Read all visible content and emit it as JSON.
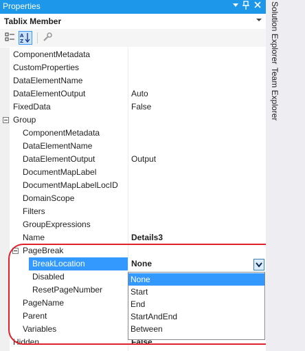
{
  "window": {
    "title": "Properties",
    "dropdown_glyph": "▼",
    "pin_glyph": "ᵖ",
    "close_glyph": "✕"
  },
  "object_selector": {
    "name": "Tablix Member",
    "arrow": "▼"
  },
  "toolbar": {
    "buttons": [
      {
        "icon": "categorized-icon",
        "active": false
      },
      {
        "icon": "alphabetical-icon",
        "active": true
      },
      {
        "icon": "property-pages-icon",
        "active": false
      }
    ]
  },
  "side_tabs": [
    "Solution Explorer",
    "Team Explorer"
  ],
  "properties": {
    "component_metadata": {
      "label": "ComponentMetadata",
      "value": ""
    },
    "custom_properties": {
      "label": "CustomProperties",
      "value": ""
    },
    "data_element_name": {
      "label": "DataElementName",
      "value": ""
    },
    "data_element_output": {
      "label": "DataElementOutput",
      "value": "Auto"
    },
    "fixed_data": {
      "label": "FixedData",
      "value": "False"
    },
    "group": {
      "label": "Group",
      "expander": "⊟",
      "component_metadata": {
        "label": "ComponentMetadata",
        "value": ""
      },
      "data_element_name": {
        "label": "DataElementName",
        "value": ""
      },
      "data_element_output": {
        "label": "DataElementOutput",
        "value": "Output"
      },
      "document_map_label": {
        "label": "DocumentMapLabel",
        "value": ""
      },
      "document_map_label_loc_id": {
        "label": "DocumentMapLabelLocID",
        "value": ""
      },
      "domain_scope": {
        "label": "DomainScope",
        "value": ""
      },
      "filters": {
        "label": "Filters",
        "value": ""
      },
      "group_expressions": {
        "label": "GroupExpressions",
        "value": ""
      },
      "name": {
        "label": "Name",
        "value": "Details3"
      },
      "page_break": {
        "label": "PageBreak",
        "expander": "⊟",
        "break_location": {
          "label": "BreakLocation",
          "value": "None"
        },
        "disabled": {
          "label": "Disabled",
          "value": ""
        },
        "reset_page_number": {
          "label": "ResetPageNumber",
          "value": ""
        }
      },
      "page_name": {
        "label": "PageName",
        "value": ""
      },
      "parent": {
        "label": "Parent",
        "value": ""
      },
      "variables": {
        "label": "Variables",
        "value": ""
      }
    },
    "hidden": {
      "label": "Hidden",
      "value": "False"
    }
  },
  "break_location_options": {
    "selected": "None",
    "items": [
      "None",
      "Start",
      "End",
      "StartAndEnd",
      "Between"
    ]
  },
  "colors": {
    "title_bar": "#1c97ea",
    "selection": "#3399ff",
    "annotation": "#e0202a"
  }
}
